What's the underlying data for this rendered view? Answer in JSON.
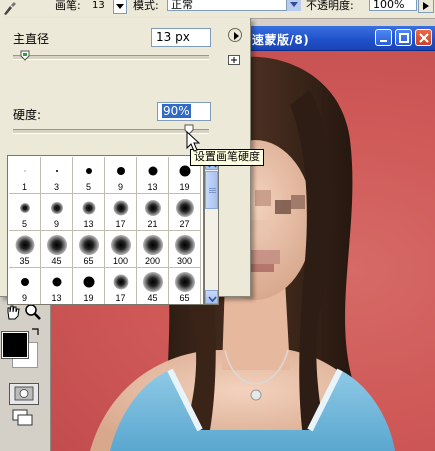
{
  "options_bar": {
    "brush_label": "画笔:",
    "brush_size": "13",
    "mode_label": "模式:",
    "mode_value": "正常",
    "opacity_label": "不透明度:",
    "opacity_value": "100%"
  },
  "document": {
    "title": "速蒙版/8)"
  },
  "brush_popup": {
    "diameter_label": "主直径",
    "diameter_value": "13 px",
    "diameter_slider_fraction": 0.06,
    "hardness_label": "硬度:",
    "hardness_value": "90%",
    "hardness_slider_fraction": 0.9,
    "tooltip": "设置画笔硬度",
    "presets": [
      {
        "size": "1",
        "kind": "hard"
      },
      {
        "size": "3",
        "kind": "hard"
      },
      {
        "size": "5",
        "kind": "hard"
      },
      {
        "size": "9",
        "kind": "hard"
      },
      {
        "size": "13",
        "kind": "hard"
      },
      {
        "size": "19",
        "kind": "hard"
      },
      {
        "size": "5",
        "kind": "soft"
      },
      {
        "size": "9",
        "kind": "soft"
      },
      {
        "size": "13",
        "kind": "soft"
      },
      {
        "size": "17",
        "kind": "soft"
      },
      {
        "size": "21",
        "kind": "soft"
      },
      {
        "size": "27",
        "kind": "soft"
      },
      {
        "size": "35",
        "kind": "soft"
      },
      {
        "size": "45",
        "kind": "soft"
      },
      {
        "size": "65",
        "kind": "soft"
      },
      {
        "size": "100",
        "kind": "soft"
      },
      {
        "size": "200",
        "kind": "soft"
      },
      {
        "size": "300",
        "kind": "soft"
      },
      {
        "size": "9",
        "kind": "hard"
      },
      {
        "size": "13",
        "kind": "hard"
      },
      {
        "size": "19",
        "kind": "hard"
      },
      {
        "size": "17",
        "kind": "soft"
      },
      {
        "size": "45",
        "kind": "soft"
      },
      {
        "size": "65",
        "kind": "soft"
      }
    ]
  },
  "colors": {
    "foreground": "#000000",
    "background": "#ffffff",
    "canvas_bg": "#cf5a58",
    "title_bar": "#2a5ed8"
  }
}
